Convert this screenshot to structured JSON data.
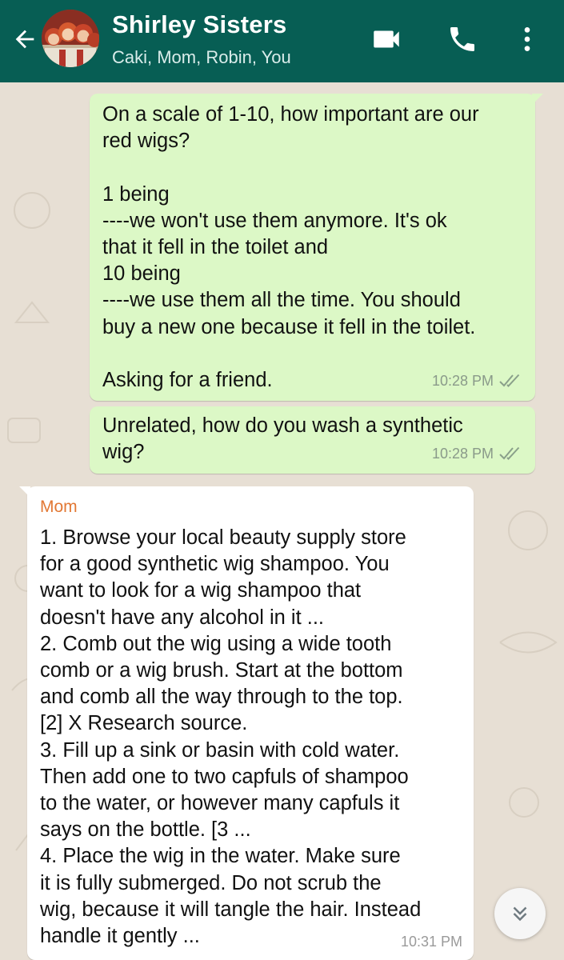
{
  "header": {
    "title": "Shirley Sisters",
    "subtitle": "Caki, Mom, Robin, You",
    "colors": {
      "bar": "#075e54",
      "text": "#ffffff"
    },
    "icons": [
      "back-arrow-icon",
      "video-call-icon",
      "phone-icon",
      "more-vert-icon"
    ]
  },
  "messages": [
    {
      "direction": "outgoing",
      "text": "On a scale of 1-10, how important are our\nred wigs?\n\n1 being\n----we won't use them anymore. It's ok\nthat it fell in the toilet and\n10 being\n----we use them all the time. You should\nbuy a new one because it fell in the toilet.\n\nAsking for a friend.",
      "time": "10:28 PM",
      "status": "read-check-icon"
    },
    {
      "direction": "outgoing",
      "text": "Unrelated, how do you wash a synthetic\nwig?",
      "time": "10:28 PM",
      "status": "read-check-icon"
    },
    {
      "direction": "incoming",
      "sender": "Mom",
      "text": "1. Browse your local beauty supply store\nfor a good synthetic wig shampoo. You\nwant to look for a wig shampoo that\ndoesn't have any alcohol in it ...\n2. Comb out the wig using a wide tooth\ncomb or a wig brush. Start at the bottom\nand comb all the way through to the top.\n[2] X Research source.\n3. Fill up a sink or basin with cold water.\nThen add one to two capfuls of shampoo\nto the water, or however many capfuls it\nsays on the bottle. [3 ...\n4. Place the wig in the water. Make sure\nit is fully submerged. Do not scrub the\nwig, because it will tangle the hair. Instead\nhandle it gently ...",
      "time": "10:31 PM"
    }
  ],
  "colors": {
    "outgoing_bubble": "#dcf8c6",
    "incoming_bubble": "#ffffff",
    "sender_name": "#e27834",
    "chat_background": "#e7dfd4"
  },
  "scroll_button": {
    "icon": "double-chevron-down-icon"
  }
}
